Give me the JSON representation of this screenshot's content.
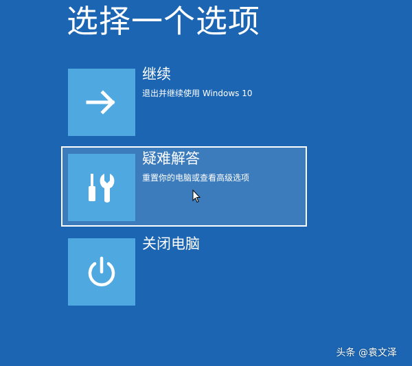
{
  "page": {
    "title": "选择一个选项"
  },
  "options": [
    {
      "label": "继续",
      "description": "退出并继续使用 Windows 10",
      "icon": "arrow-right-icon"
    },
    {
      "label": "疑难解答",
      "description": "重置你的电脑或查看高级选项",
      "icon": "tools-icon",
      "selected": true
    },
    {
      "label": "关闭电脑",
      "description": "",
      "icon": "power-icon"
    }
  ],
  "watermark": "头条 @袁文泽",
  "colors": {
    "background": "#1b65b2",
    "tile": "#4fa8e0",
    "text": "#ffffff"
  }
}
